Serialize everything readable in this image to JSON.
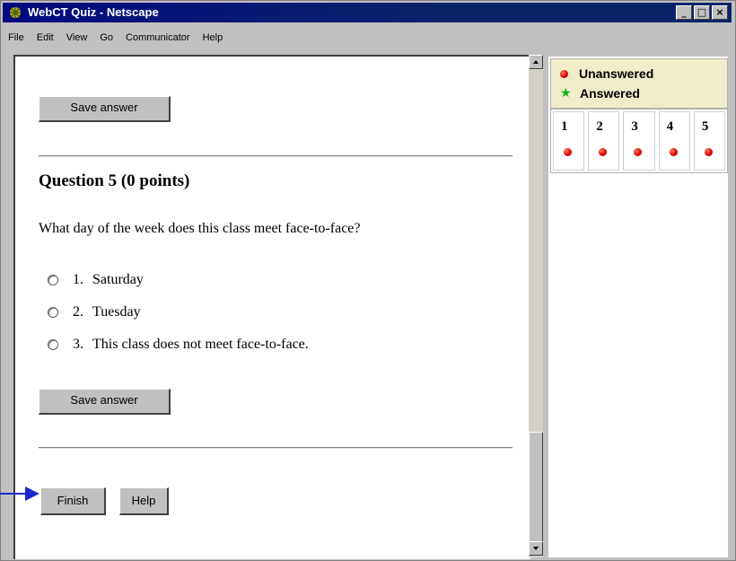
{
  "window": {
    "title": "WebCT Quiz - Netscape",
    "controls": [
      "_",
      "□",
      "×"
    ]
  },
  "menubar": {
    "items": [
      "File",
      "Edit",
      "View",
      "Go",
      "Communicator",
      "Help"
    ]
  },
  "quiz": {
    "save_answer_label": "Save answer",
    "question": {
      "title": "Question 5  (0 points)",
      "text": "What day of the week does this class meet face-to-face?",
      "options": [
        {
          "number": "1.",
          "text": "Saturday"
        },
        {
          "number": "2.",
          "text": "Tuesday"
        },
        {
          "number": "3.",
          "text": "This class does not meet face-to-face."
        }
      ]
    },
    "finish_label": "Finish",
    "help_label": "Help"
  },
  "status_panel": {
    "legend": {
      "unanswered": "Unanswered",
      "answered": "Answered"
    },
    "questions": [
      {
        "number": "1",
        "status": "unanswered"
      },
      {
        "number": "2",
        "status": "unanswered"
      },
      {
        "number": "3",
        "status": "unanswered"
      },
      {
        "number": "4",
        "status": "unanswered"
      },
      {
        "number": "5",
        "status": "unanswered"
      }
    ]
  },
  "colors": {
    "titlebar": "#0a246a",
    "unanswered_dot": "#e00000",
    "answered_star": "#10b010",
    "pointer_arrow": "#1a2ad0"
  }
}
